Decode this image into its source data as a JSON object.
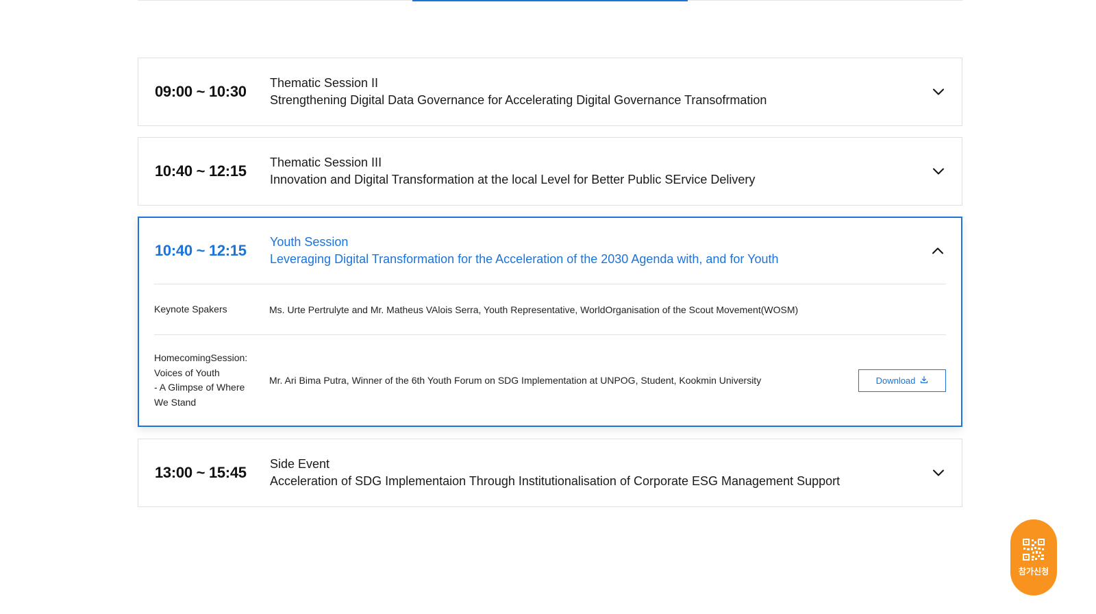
{
  "colors": {
    "accent": "#1b74d9",
    "fab": "#f7931e",
    "border": "#e1e1e1",
    "text": "#111111"
  },
  "sessions": [
    {
      "time": "09:00 ~ 10:30",
      "title": "Thematic Session II",
      "subtitle": "Strengthening Digital Data Governance for Accelerating Digital Governance Transofrmation",
      "expanded": false,
      "toggle_icon": "chevron-down-icon"
    },
    {
      "time": "10:40 ~ 12:15",
      "title": "Thematic Session III",
      "subtitle": "Innovation and Digital Transformation at the local Level for Better Public SErvice Delivery",
      "expanded": false,
      "toggle_icon": "chevron-down-icon"
    },
    {
      "time": "10:40 ~ 12:15",
      "title": "Youth Session",
      "subtitle": "Leveraging Digital Transformation for the Acceleration of the 2030 Agenda with, and for Youth",
      "expanded": true,
      "toggle_icon": "chevron-up-icon",
      "details": [
        {
          "label": "Keynote Spakers",
          "text": "Ms. Urte Pertrulyte and Mr. Matheus VAlois Serra, Youth Representative, WorldOrganisation of the Scout Movement(WOSM)"
        },
        {
          "label": "HomecomingSession:\nVoices of Youth\n- A Glimpse of Where\nWe Stand",
          "text": "Mr. Ari Bima Putra, Winner of the 6th Youth Forum on SDG Implementation at UNPOG, Student, Kookmin University",
          "button_label": "Download",
          "button_icon": "download-icon"
        }
      ]
    },
    {
      "time": "13:00 ~ 15:45",
      "title": "Side Event",
      "subtitle": "Acceleration of SDG Implementaion Through Institutionalisation of Corporate ESG Management Support",
      "expanded": false,
      "toggle_icon": "chevron-down-icon"
    }
  ],
  "apply_button": {
    "label": "참가신청",
    "icon": "qr-code-icon"
  }
}
